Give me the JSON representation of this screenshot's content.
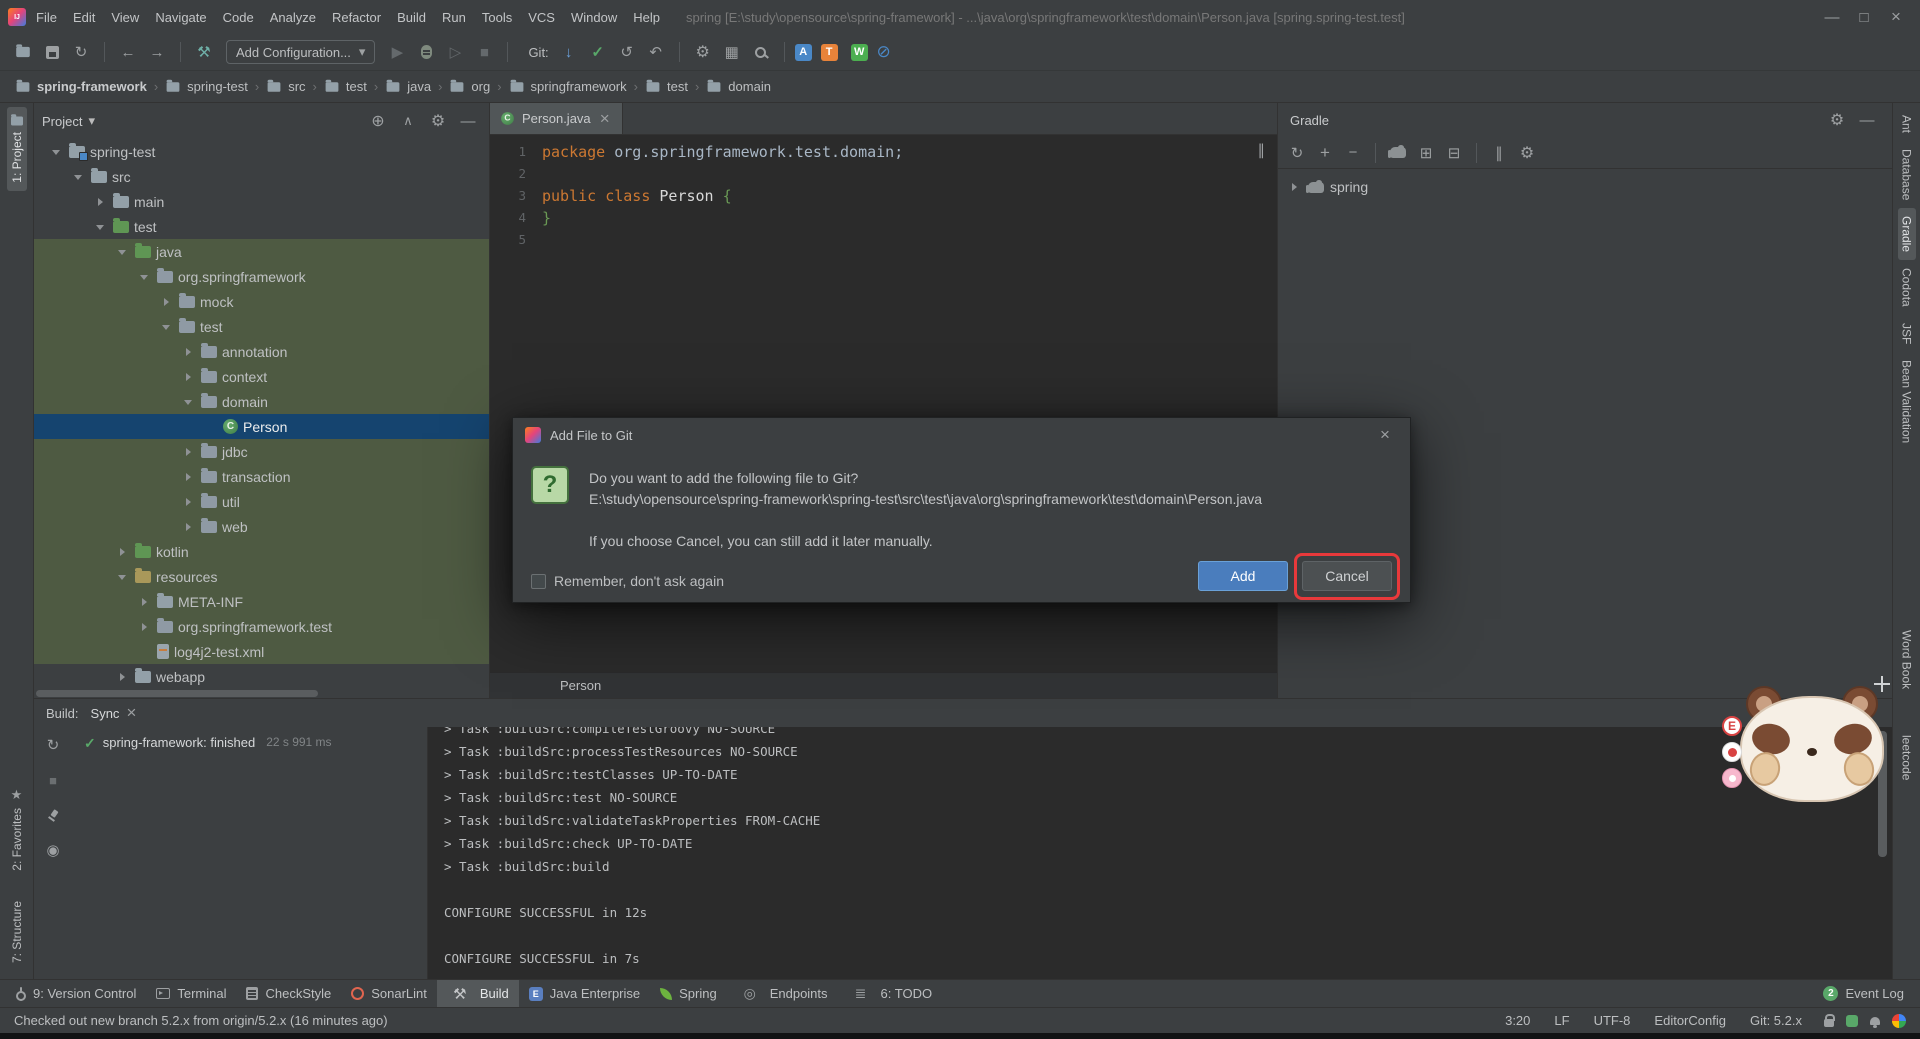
{
  "colors": {
    "panel_bg": "#3c3f41",
    "editor_bg": "#2b2b2b",
    "border": "#323232",
    "selection_blue": "#15446f",
    "test_scope_green": "#4e5a42",
    "keyword_orange": "#cc7832",
    "code_text": "#a9b7c6",
    "brace_green": "#6a9955",
    "success_green": "#59a869",
    "add_button_blue": "#4a7dbd",
    "annotation_red": "#e8393b"
  },
  "window": {
    "title": "spring [E:\\study\\opensource\\spring-framework] - ...\\java\\org\\springframework\\test\\domain\\Person.java [spring.spring-test.test]"
  },
  "menu_bar": {
    "items": [
      "File",
      "Edit",
      "View",
      "Navigate",
      "Code",
      "Analyze",
      "Refactor",
      "Build",
      "Run",
      "Tools",
      "VCS",
      "Window",
      "Help"
    ]
  },
  "toolbar": {
    "run_config_label": "Add Configuration...",
    "git_label": "Git:"
  },
  "breadcrumbs": [
    "spring-framework",
    "spring-test",
    "src",
    "test",
    "java",
    "org",
    "springframework",
    "test",
    "domain"
  ],
  "left_stripe": {
    "top": [
      {
        "label": "1: Project",
        "icon": "folder"
      }
    ],
    "bottom": [
      {
        "label": "2: Favorites",
        "icon": "star"
      },
      {
        "label": "7: Structure",
        "icon": ""
      }
    ]
  },
  "right_stripe": [
    {
      "label": "Ant"
    },
    {
      "label": "Database"
    },
    {
      "label": "Gradle",
      "active": true
    },
    {
      "label": "Codota"
    },
    {
      "label": "JSF"
    },
    {
      "label": "Bean Validation"
    },
    {
      "label": "Word Book",
      "gap_before": 170
    },
    {
      "label": "leetcode",
      "gap_before": 30
    }
  ],
  "project_panel": {
    "title": "Project",
    "rows": [
      {
        "label": "spring-test",
        "level": 0,
        "icon": "module",
        "state": "expanded"
      },
      {
        "label": "src",
        "level": 1,
        "icon": "folder",
        "state": "expanded"
      },
      {
        "label": "main",
        "level": 2,
        "icon": "folder",
        "state": "collapsed"
      },
      {
        "label": "test",
        "level": 2,
        "icon": "folder-green",
        "state": "expanded"
      },
      {
        "label": "java",
        "level": 3,
        "icon": "folder-green",
        "state": "expanded",
        "scope": "test"
      },
      {
        "label": "org.springframework",
        "level": 4,
        "icon": "package",
        "state": "expanded",
        "scope": "test"
      },
      {
        "label": "mock",
        "level": 5,
        "icon": "package",
        "state": "collapsed",
        "scope": "test"
      },
      {
        "label": "test",
        "level": 5,
        "icon": "package",
        "state": "expanded",
        "scope": "test"
      },
      {
        "label": "annotation",
        "level": 6,
        "icon": "package",
        "state": "collapsed",
        "scope": "test"
      },
      {
        "label": "context",
        "level": 6,
        "icon": "package",
        "state": "collapsed",
        "scope": "test"
      },
      {
        "label": "domain",
        "level": 6,
        "icon": "package",
        "state": "expanded",
        "scope": "test"
      },
      {
        "label": "Person",
        "level": 7,
        "icon": "class",
        "state": "leaf",
        "selected": true
      },
      {
        "label": "jdbc",
        "level": 6,
        "icon": "package",
        "state": "collapsed",
        "scope": "test"
      },
      {
        "label": "transaction",
        "level": 6,
        "icon": "package",
        "state": "collapsed",
        "scope": "test"
      },
      {
        "label": "util",
        "level": 6,
        "icon": "package",
        "state": "collapsed",
        "scope": "test"
      },
      {
        "label": "web",
        "level": 6,
        "icon": "package",
        "state": "collapsed",
        "scope": "test"
      },
      {
        "label": "kotlin",
        "level": 3,
        "icon": "folder-green",
        "state": "collapsed",
        "scope": "test"
      },
      {
        "label": "resources",
        "level": 3,
        "icon": "folder-resources",
        "state": "expanded",
        "scope": "test"
      },
      {
        "label": "META-INF",
        "level": 4,
        "icon": "folder",
        "state": "collapsed",
        "scope": "test"
      },
      {
        "label": "org.springframework.test",
        "level": 4,
        "icon": "package",
        "state": "collapsed",
        "scope": "test"
      },
      {
        "label": "log4j2-test.xml",
        "level": 4,
        "icon": "file-xml",
        "state": "leaf",
        "scope": "test"
      },
      {
        "label": "webapp",
        "level": 3,
        "icon": "folder",
        "state": "collapsed"
      }
    ]
  },
  "editor": {
    "tab_label": "Person.java",
    "bottom_breadcrumb": "Person",
    "lines": [
      {
        "num": "1",
        "tokens": [
          {
            "text": "package ",
            "cls": "kw"
          },
          {
            "text": "org.springframework.test.domain;",
            "cls": "pl"
          }
        ]
      },
      {
        "num": "2",
        "tokens": []
      },
      {
        "num": "3",
        "tokens": [
          {
            "text": "public class ",
            "cls": "kw"
          },
          {
            "text": "Person ",
            "cls": "id"
          },
          {
            "text": "{",
            "cls": "br"
          }
        ]
      },
      {
        "num": "4",
        "tokens": [
          {
            "text": "}",
            "cls": "br"
          }
        ]
      },
      {
        "num": "5",
        "tokens": []
      }
    ]
  },
  "gradle_panel": {
    "title": "Gradle",
    "root_node": "spring"
  },
  "dialog": {
    "title": "Add File to Git",
    "question": "Do you want to add the following file to Git?",
    "file_path": "E:\\study\\opensource\\spring-framework\\spring-test\\src\\test\\java\\org\\springframework\\test\\domain\\Person.java",
    "note": "If you choose Cancel, you can still add it later manually.",
    "checkbox_label": "Remember, don't ask again",
    "checkbox_checked": false,
    "add_label": "Add",
    "cancel_label": "Cancel"
  },
  "build_panel": {
    "panel_label": "Build:",
    "tab_label": "Sync",
    "status_title": "spring-framework: finished",
    "status_time": "22 s 991 ms",
    "console_lines": [
      "> Task :buildSrc:compileTestGroovy NO-SOURCE",
      "> Task :buildSrc:processTestResources NO-SOURCE",
      "> Task :buildSrc:testClasses UP-TO-DATE",
      "> Task :buildSrc:test NO-SOURCE",
      "> Task :buildSrc:validateTaskProperties FROM-CACHE",
      "> Task :buildSrc:check UP-TO-DATE",
      "> Task :buildSrc:build",
      "",
      "CONFIGURE SUCCESSFUL in 12s",
      "",
      "CONFIGURE SUCCESSFUL in 7s"
    ]
  },
  "tool_buttons": {
    "left": [
      {
        "label": "9: Version Control",
        "icon": "branch"
      },
      {
        "label": "Terminal",
        "icon": "terminal"
      },
      {
        "label": "CheckStyle",
        "icon": "checkstyle"
      },
      {
        "label": "SonarLint",
        "icon": "sonarlint"
      },
      {
        "label": "Build",
        "icon": "hammer",
        "active": true
      },
      {
        "label": "Java Enterprise",
        "icon": "javaee"
      },
      {
        "label": "Spring",
        "icon": "spring"
      },
      {
        "label": "Endpoints",
        "icon": "endpoints"
      },
      {
        "label": "6: TODO",
        "icon": "todo"
      }
    ],
    "right": [
      {
        "label": "Event Log",
        "icon": "eventlog",
        "badge": "2"
      }
    ]
  },
  "status_bar": {
    "message": "Checked out new branch 5.2.x from origin/5.2.x (16 minutes ago)",
    "items": [
      "3:20",
      "LF",
      "UTF-8",
      "EditorConfig",
      "Git: 5.2.x"
    ]
  },
  "mascot": {
    "badges": [
      {
        "kind": "letter",
        "value": "E"
      },
      {
        "kind": "dot",
        "value": ""
      },
      {
        "kind": "flower",
        "value": ""
      }
    ]
  }
}
